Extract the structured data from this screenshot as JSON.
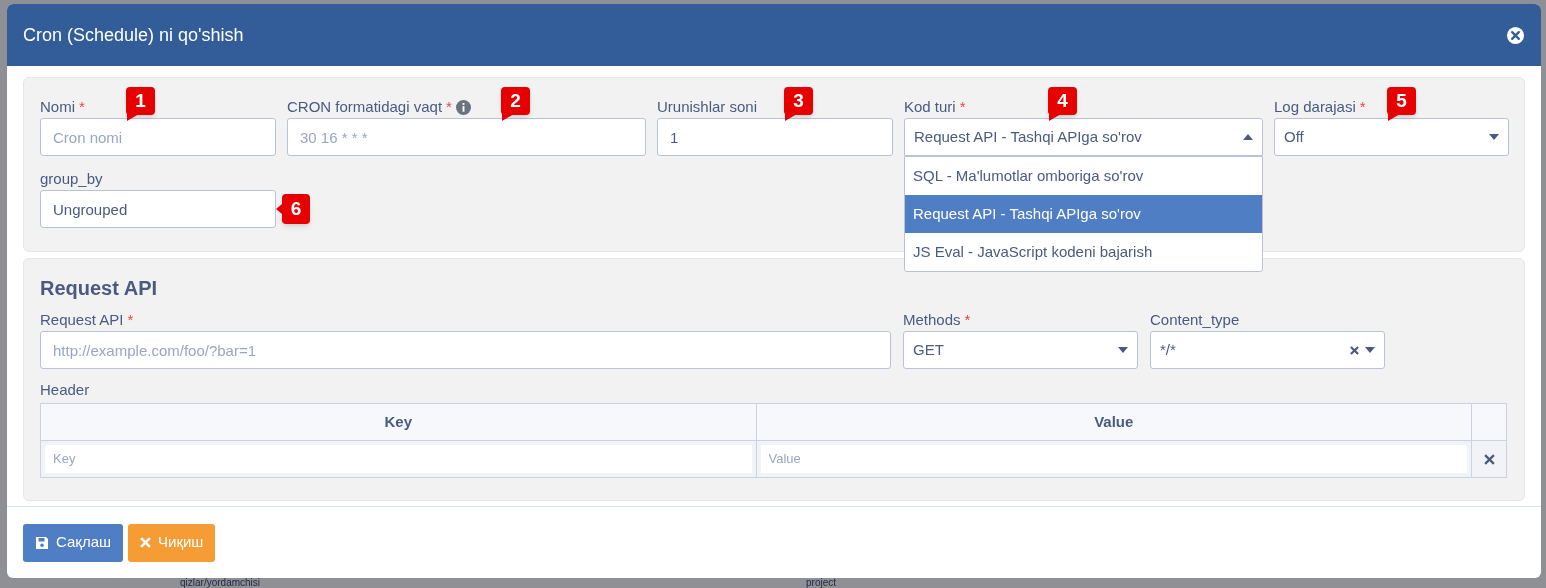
{
  "dialog": {
    "title": "Cron (Schedule) ni qo'shish"
  },
  "main_fields": [
    {
      "kind": "input",
      "label": "Nomi",
      "required_mark": "*",
      "placeholder": "Cron nomi",
      "callout": "1"
    },
    {
      "kind": "input",
      "label": "CRON formatidagi vaqt",
      "required_mark": "*",
      "info": true,
      "placeholder": "30 16 * * *",
      "callout": "2"
    },
    {
      "kind": "input",
      "label": "Urunishlar soni",
      "value": "1",
      "callout": "3"
    },
    {
      "kind": "select",
      "label": "Kod turi",
      "required_mark": "*",
      "value": "Request API - Tashqi APIga so'rov",
      "expanded": true,
      "callout": "4",
      "options": [
        {
          "label": "SQL - Ma'lumotlar omboriga so'rov",
          "selected": false
        },
        {
          "label": "Request API - Tashqi APIga so'rov",
          "selected": true
        },
        {
          "label": "JS Eval - JavaScript kodeni bajarish",
          "selected": false
        }
      ]
    },
    {
      "kind": "select",
      "label": "Log darajasi",
      "required_mark": "*",
      "value": "Off",
      "expanded": false,
      "callout": "5"
    }
  ],
  "group_field": {
    "label": "group_by",
    "value": "Ungrouped",
    "callout": "6"
  },
  "request_section": {
    "title": "Request API",
    "fields": [
      {
        "kind": "input",
        "label": "Request API",
        "required_mark": "*",
        "placeholder": "http://example.com/foo/?bar=1"
      },
      {
        "kind": "select",
        "label": "Methods",
        "required_mark": "*",
        "value": "GET",
        "clearable": false
      },
      {
        "kind": "select",
        "label": "Content_type",
        "value": "*/*",
        "clearable": true
      }
    ],
    "header_label": "Header",
    "table": {
      "columns": [
        "Key",
        "Value"
      ],
      "rows": [
        {
          "key_placeholder": "Key",
          "value_placeholder": "Value"
        }
      ]
    }
  },
  "buttons": [
    {
      "kind": "save",
      "label": "Сақлаш"
    },
    {
      "kind": "cancel",
      "label": "Чиқиш"
    }
  ],
  "background_texts": [
    "qizlar/yordamchisi",
    "project"
  ]
}
